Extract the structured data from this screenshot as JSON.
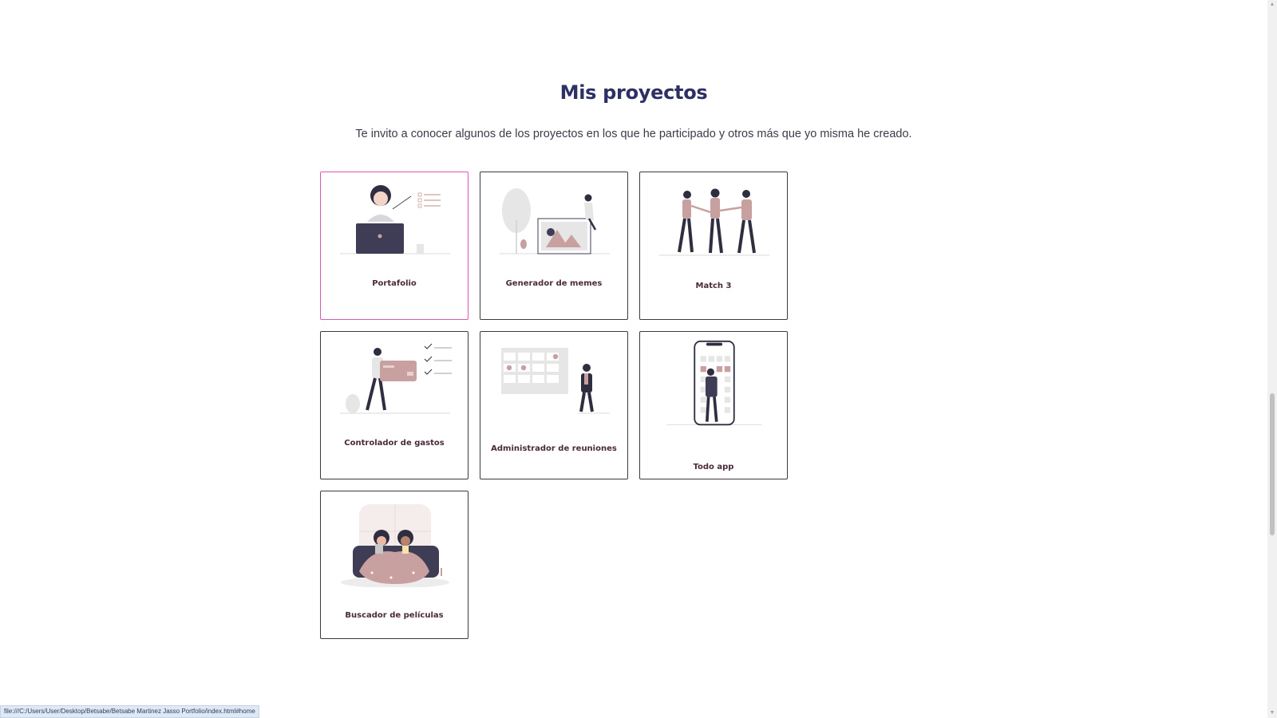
{
  "section": {
    "title": "Mis proyectos",
    "subtitle": "Te invito a conocer algunos de los proyectos en los que he participado y otros más que yo misma he creado."
  },
  "projects": [
    {
      "label": "Portafolio",
      "illustration": "woman-laptop-checklist"
    },
    {
      "label": "Generador de memes",
      "illustration": "person-image-frame"
    },
    {
      "label": "Match 3",
      "illustration": "three-people-holding-hands"
    },
    {
      "label": "Controlador de gastos",
      "illustration": "man-credit-card-checklist"
    },
    {
      "label": "Administrador de reuniones",
      "illustration": "calendar-person"
    },
    {
      "label": "Todo app",
      "illustration": "phone-calendar-person"
    },
    {
      "label": "Buscador de películas",
      "illustration": "two-people-couch-popcorn"
    }
  ],
  "statusbar": {
    "url": "file:///C:/Users/User/Desktop/Betsabe/Betsabe Martinez Jasso Portfolio/index.html#home"
  },
  "colors": {
    "title": "#2e2f63",
    "accent_border": "#d65ab5",
    "illustration_pink": "#c9a0a0",
    "illustration_dark": "#2f2e41"
  }
}
